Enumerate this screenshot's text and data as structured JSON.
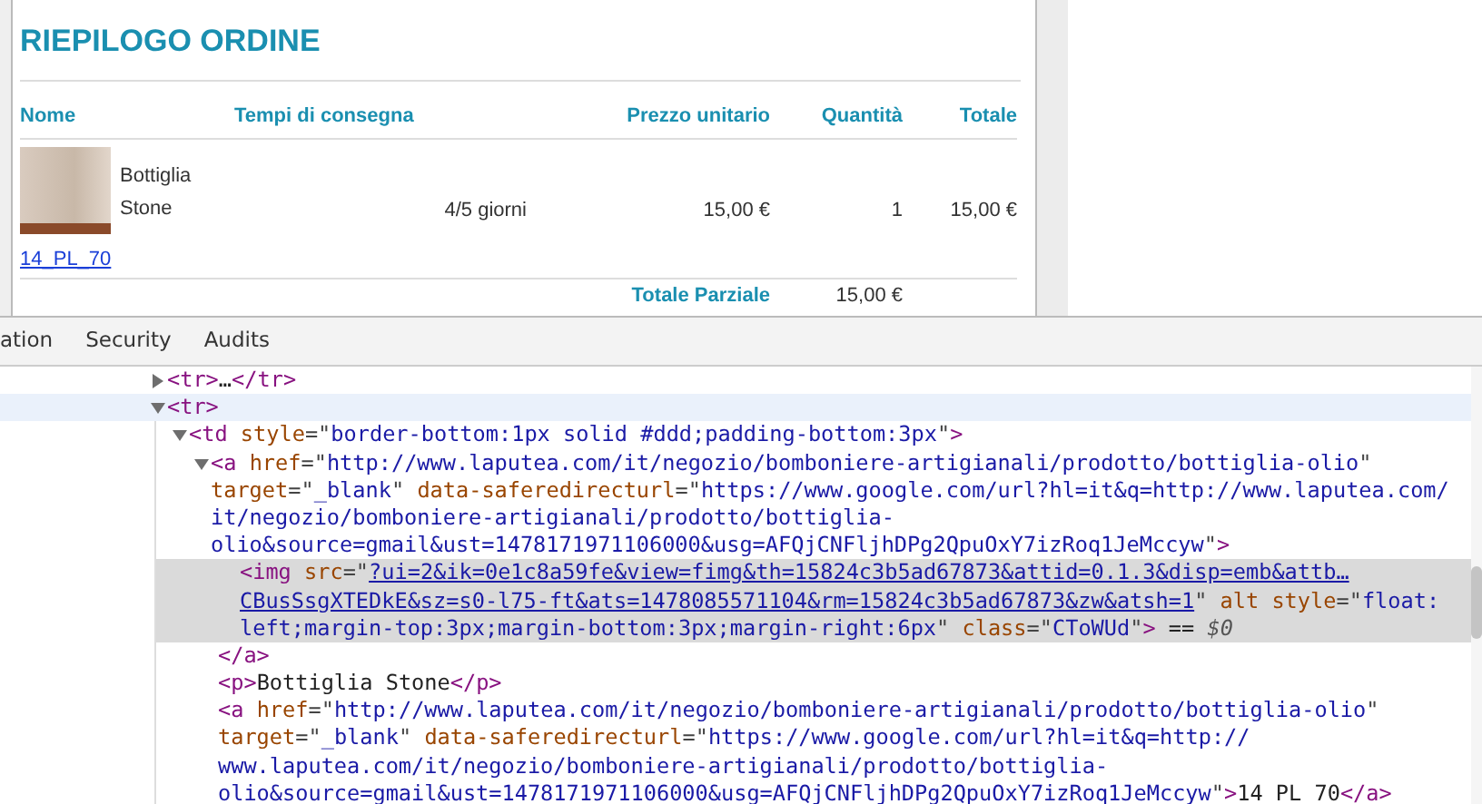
{
  "order_summary": {
    "title": "RIEPILOGO ORDINE",
    "columns": [
      "Nome",
      "Tempi di consegna",
      "Prezzo unitario",
      "Quantità",
      "Totale"
    ],
    "items": [
      {
        "name": "Bottiglia Stone",
        "delivery": "4/5 giorni",
        "unit_price": "15,00 €",
        "quantity": "1",
        "total": "15,00 €",
        "code_link": "14_PL_70"
      }
    ],
    "subtotal": {
      "label": "Totale Parziale",
      "value": "15,00 €"
    }
  },
  "devtools": {
    "tabs": [
      {
        "label": "ation",
        "selected": false
      },
      {
        "label": "Security",
        "selected": false
      },
      {
        "label": "Audits",
        "selected": false
      }
    ],
    "dom_tree": [
      {
        "expanded": false,
        "hovered": false,
        "selected": false,
        "lines": [
          [
            {
              "kind": "tag",
              "text": "<tr>"
            },
            {
              "kind": "text",
              "text": "…"
            },
            {
              "kind": "tag",
              "text": "</tr>"
            }
          ]
        ]
      },
      {
        "expanded": true,
        "hovered": true,
        "selected": false,
        "lines": [
          [
            {
              "kind": "tag",
              "text": "<tr>"
            }
          ]
        ],
        "children": [
          {
            "expanded": true,
            "hovered": false,
            "selected": false,
            "lines": [
              [
                {
                  "kind": "tag",
                  "text": "<td "
                },
                {
                  "kind": "attr",
                  "text": "style"
                },
                {
                  "kind": "punct",
                  "text": "=\""
                },
                {
                  "kind": "value",
                  "text": "border-bottom:1px solid #ddd;padding-bottom:3px"
                },
                {
                  "kind": "punct",
                  "text": "\""
                },
                {
                  "kind": "tag",
                  "text": ">"
                }
              ]
            ],
            "children": [
              {
                "expanded": true,
                "hovered": false,
                "selected": false,
                "lines": [
                  [
                    {
                      "kind": "tag",
                      "text": "<a "
                    },
                    {
                      "kind": "attr",
                      "text": "href"
                    },
                    {
                      "kind": "punct",
                      "text": "=\""
                    },
                    {
                      "kind": "value",
                      "text": "http://www.laputea.com/it/negozio/bomboniere-artigianali/prodotto/bottiglia-olio"
                    },
                    {
                      "kind": "punct",
                      "text": "\""
                    }
                  ],
                  [
                    {
                      "kind": "attr",
                      "text": "target"
                    },
                    {
                      "kind": "punct",
                      "text": "=\""
                    },
                    {
                      "kind": "value",
                      "text": "_blank"
                    },
                    {
                      "kind": "punct",
                      "text": "\" "
                    },
                    {
                      "kind": "attr",
                      "text": "data-saferedirecturl"
                    },
                    {
                      "kind": "punct",
                      "text": "=\""
                    },
                    {
                      "kind": "value",
                      "text": "https://www.google.com/url?hl=it&q=http://www.laputea.com/"
                    }
                  ],
                  [
                    {
                      "kind": "value",
                      "text": "it/negozio/bomboniere-artigianali/prodotto/bottiglia-"
                    }
                  ],
                  [
                    {
                      "kind": "value",
                      "text": "olio&source=gmail&ust=1478171971106000&usg=AFQjCNFljhDPg2QpuOxY7izRoq1JeMccyw"
                    },
                    {
                      "kind": "punct",
                      "text": "\""
                    },
                    {
                      "kind": "tag",
                      "text": ">"
                    }
                  ]
                ],
                "children": [
                  {
                    "hovered": false,
                    "selected": true,
                    "lines": [
                      [
                        {
                          "kind": "tag",
                          "text": "<img "
                        },
                        {
                          "kind": "attr",
                          "text": "src"
                        },
                        {
                          "kind": "punct",
                          "text": "=\""
                        },
                        {
                          "kind": "link",
                          "text": "?ui=2&ik=0e1c8a59fe&view=fimg&th=15824c3b5ad67873&attid=0.1.3&disp=emb&attb…"
                        }
                      ],
                      [
                        {
                          "kind": "link",
                          "text": "CBusSsgXTEDkE&sz=s0-l75-ft&ats=1478085571104&rm=15824c3b5ad67873&zw&atsh=1"
                        },
                        {
                          "kind": "punct",
                          "text": "\" "
                        },
                        {
                          "kind": "attr",
                          "text": "alt style"
                        },
                        {
                          "kind": "punct",
                          "text": "=\""
                        },
                        {
                          "kind": "value",
                          "text": "float:"
                        }
                      ],
                      [
                        {
                          "kind": "value",
                          "text": "left;margin-top:3px;margin-bottom:3px;margin-right:6px"
                        },
                        {
                          "kind": "punct",
                          "text": "\" "
                        },
                        {
                          "kind": "attr",
                          "text": "class"
                        },
                        {
                          "kind": "punct",
                          "text": "=\""
                        },
                        {
                          "kind": "value",
                          "text": "CToWUd"
                        },
                        {
                          "kind": "punct",
                          "text": "\""
                        },
                        {
                          "kind": "tag",
                          "text": ">"
                        },
                        {
                          "kind": "text",
                          "text": " == "
                        },
                        {
                          "kind": "note",
                          "text": "$0"
                        }
                      ]
                    ]
                  }
                ]
              },
              {
                "hovered": false,
                "selected": false,
                "lines": [
                  [
                    {
                      "kind": "tag",
                      "text": "</a>"
                    }
                  ]
                ]
              },
              {
                "hovered": false,
                "selected": false,
                "lines": [
                  [
                    {
                      "kind": "tag",
                      "text": "<p>"
                    },
                    {
                      "kind": "text",
                      "text": "Bottiglia Stone"
                    },
                    {
                      "kind": "tag",
                      "text": "</p>"
                    }
                  ]
                ]
              },
              {
                "hovered": false,
                "selected": false,
                "lines": [
                  [
                    {
                      "kind": "tag",
                      "text": "<a "
                    },
                    {
                      "kind": "attr",
                      "text": "href"
                    },
                    {
                      "kind": "punct",
                      "text": "=\""
                    },
                    {
                      "kind": "value",
                      "text": "http://www.laputea.com/it/negozio/bomboniere-artigianali/prodotto/bottiglia-olio"
                    },
                    {
                      "kind": "punct",
                      "text": "\""
                    }
                  ],
                  [
                    {
                      "kind": "attr",
                      "text": "target"
                    },
                    {
                      "kind": "punct",
                      "text": "=\""
                    },
                    {
                      "kind": "value",
                      "text": "_blank"
                    },
                    {
                      "kind": "punct",
                      "text": "\" "
                    },
                    {
                      "kind": "attr",
                      "text": "data-saferedirecturl"
                    },
                    {
                      "kind": "punct",
                      "text": "=\""
                    },
                    {
                      "kind": "value",
                      "text": "https://www.google.com/url?hl=it&q=http://"
                    }
                  ],
                  [
                    {
                      "kind": "value",
                      "text": "www.laputea.com/it/negozio/bomboniere-artigianali/prodotto/bottiglia-"
                    }
                  ],
                  [
                    {
                      "kind": "value",
                      "text": "olio&source=gmail&ust=1478171971106000&usg=AFQjCNFljhDPg2QpuOxY7izRoq1JeMccyw"
                    },
                    {
                      "kind": "punct",
                      "text": "\""
                    },
                    {
                      "kind": "tag",
                      "text": ">"
                    },
                    {
                      "kind": "text",
                      "text": "14_PL_70"
                    },
                    {
                      "kind": "tag",
                      "text": "</a>"
                    }
                  ]
                ]
              }
            ]
          }
        ]
      }
    ]
  }
}
